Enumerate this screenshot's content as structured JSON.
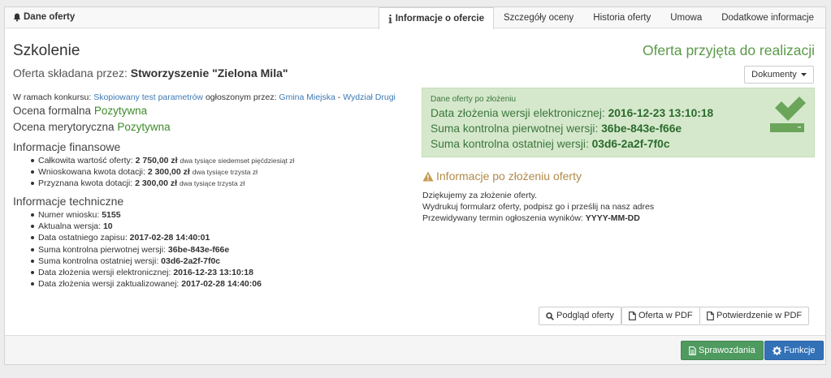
{
  "header": {
    "panel_title": "Dane oferty",
    "tabs": [
      {
        "label": "Informacje o ofercie",
        "active": true
      },
      {
        "label": "Szczegóły oceny",
        "active": false
      },
      {
        "label": "Historia oferty",
        "active": false
      },
      {
        "label": "Umowa",
        "active": false
      },
      {
        "label": "Dodatkowe informacje",
        "active": false
      }
    ]
  },
  "main": {
    "title": "Szkolenie",
    "status": "Oferta przyjęta do realizacji",
    "submitter_label": "Oferta składana przez:",
    "submitter_name": "Stworzyszenie \"Zielona Mila\"",
    "documents_button": "Dokumenty",
    "konkurs_prefix": "W ramach konkursu:",
    "konkurs_link": "Skopiowany test parametrów",
    "konkurs_mid": "ogłoszonym przez:",
    "organizer_link": "Gmina Miejska",
    "organizer_sep": "-",
    "department_link": "Wydział Drugi",
    "formal_label": "Ocena formalna",
    "formal_value": "Pozytywna",
    "merit_label": "Ocena merytoryczna",
    "merit_value": "Pozytywna"
  },
  "financial": {
    "heading": "Informacje finansowe",
    "items": [
      {
        "label": "Całkowita wartość oferty:",
        "value": "2 750,00 zł",
        "words": "dwa tysiące siedemset pięćdziesiąt zł"
      },
      {
        "label": "Wnioskowana kwota dotacji:",
        "value": "2 300,00 zł",
        "words": "dwa tysiące trzysta zł"
      },
      {
        "label": "Przyznana kwota dotacji:",
        "value": "2 300,00 zł",
        "words": "dwa tysiące trzysta zł"
      }
    ]
  },
  "technical": {
    "heading": "Informacje techniczne",
    "items": [
      {
        "label": "Numer wniosku:",
        "value": "5155"
      },
      {
        "label": "Aktualna wersja:",
        "value": "10"
      },
      {
        "label": "Data ostatniego zapisu:",
        "value": "2017-02-28 14:40:01"
      },
      {
        "label": "Suma kontrolna pierwotnej wersji:",
        "value": "36be-843e-f66e"
      },
      {
        "label": "Suma kontrolna ostatniej wersji:",
        "value": "03d6-2a2f-7f0c"
      },
      {
        "label": "Data złożenia wersji elektronicznej:",
        "value": "2016-12-23 13:10:18"
      },
      {
        "label": "Data złożenia wersji zaktualizowanej:",
        "value": "2017-02-28 14:40:06"
      }
    ]
  },
  "submitted_box": {
    "heading": "Dane oferty po złożeniu",
    "lines": [
      {
        "label": "Data złożenia wersji elektronicznej:",
        "value": "2016-12-23 13:10:18"
      },
      {
        "label": "Suma kontrolna pierwotnej wersji:",
        "value": "36be-843e-f66e"
      },
      {
        "label": "Suma kontrolna ostatniej wersji:",
        "value": "03d6-2a2f-7f0c"
      }
    ],
    "color": "#d5e8cc"
  },
  "after_submit": {
    "heading": "Informacje po złożeniu oferty",
    "line1": "Dziękujemy za złożenie oferty.",
    "line2": "Wydrukuj formularz oferty, podpisz go i prześlij na nasz adres",
    "line3_label": "Przewidywany termin ogłoszenia wyników:",
    "line3_value": "YYYY-MM-DD"
  },
  "actions": {
    "preview": "Podgląd oferty",
    "pdf": "Oferta w PDF",
    "confirmation": "Potwierdzenie w PDF"
  },
  "footer": {
    "reports": "Sprawozdania",
    "functions": "Funkcje"
  }
}
